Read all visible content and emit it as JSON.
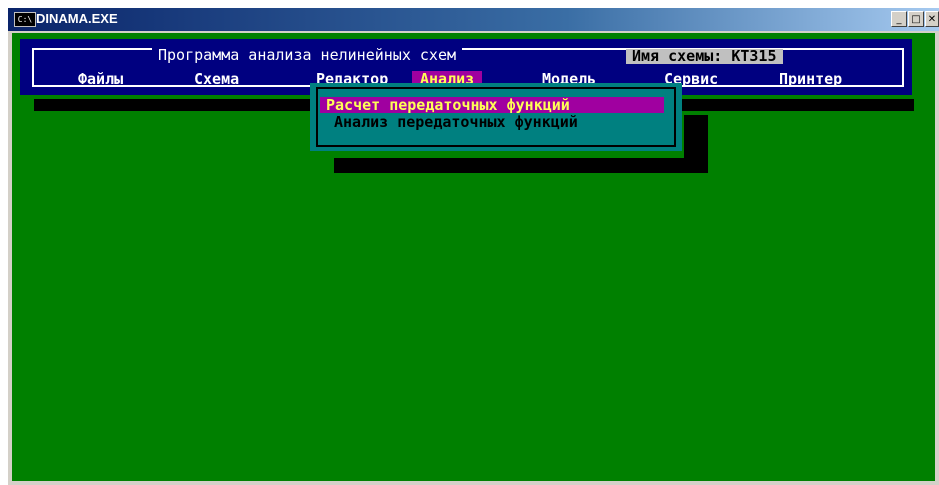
{
  "window": {
    "title": "DINAMA.EXE",
    "icon_label": "C:\\",
    "controls": {
      "minimize": "_",
      "maximize": "□",
      "close": "✕"
    }
  },
  "header": {
    "program_title": "Программа анализа нелинейных схем",
    "schema_label": "Имя схемы: КТ315"
  },
  "menu": {
    "items": [
      "Файлы",
      "Схема",
      "Редактор",
      "Анализ",
      "Модель",
      "Сервис",
      "Принтер"
    ],
    "active": "Анализ"
  },
  "dropdown": {
    "items": [
      "Расчет передаточных функций",
      "Анализ передаточных функций"
    ],
    "selected": "Расчет передаточных функций"
  },
  "colors": {
    "background": "#008000",
    "menu_bar": "#000080",
    "dropdown": "#008080",
    "highlight": "#a000a0",
    "highlight_text": "#ffff55"
  }
}
